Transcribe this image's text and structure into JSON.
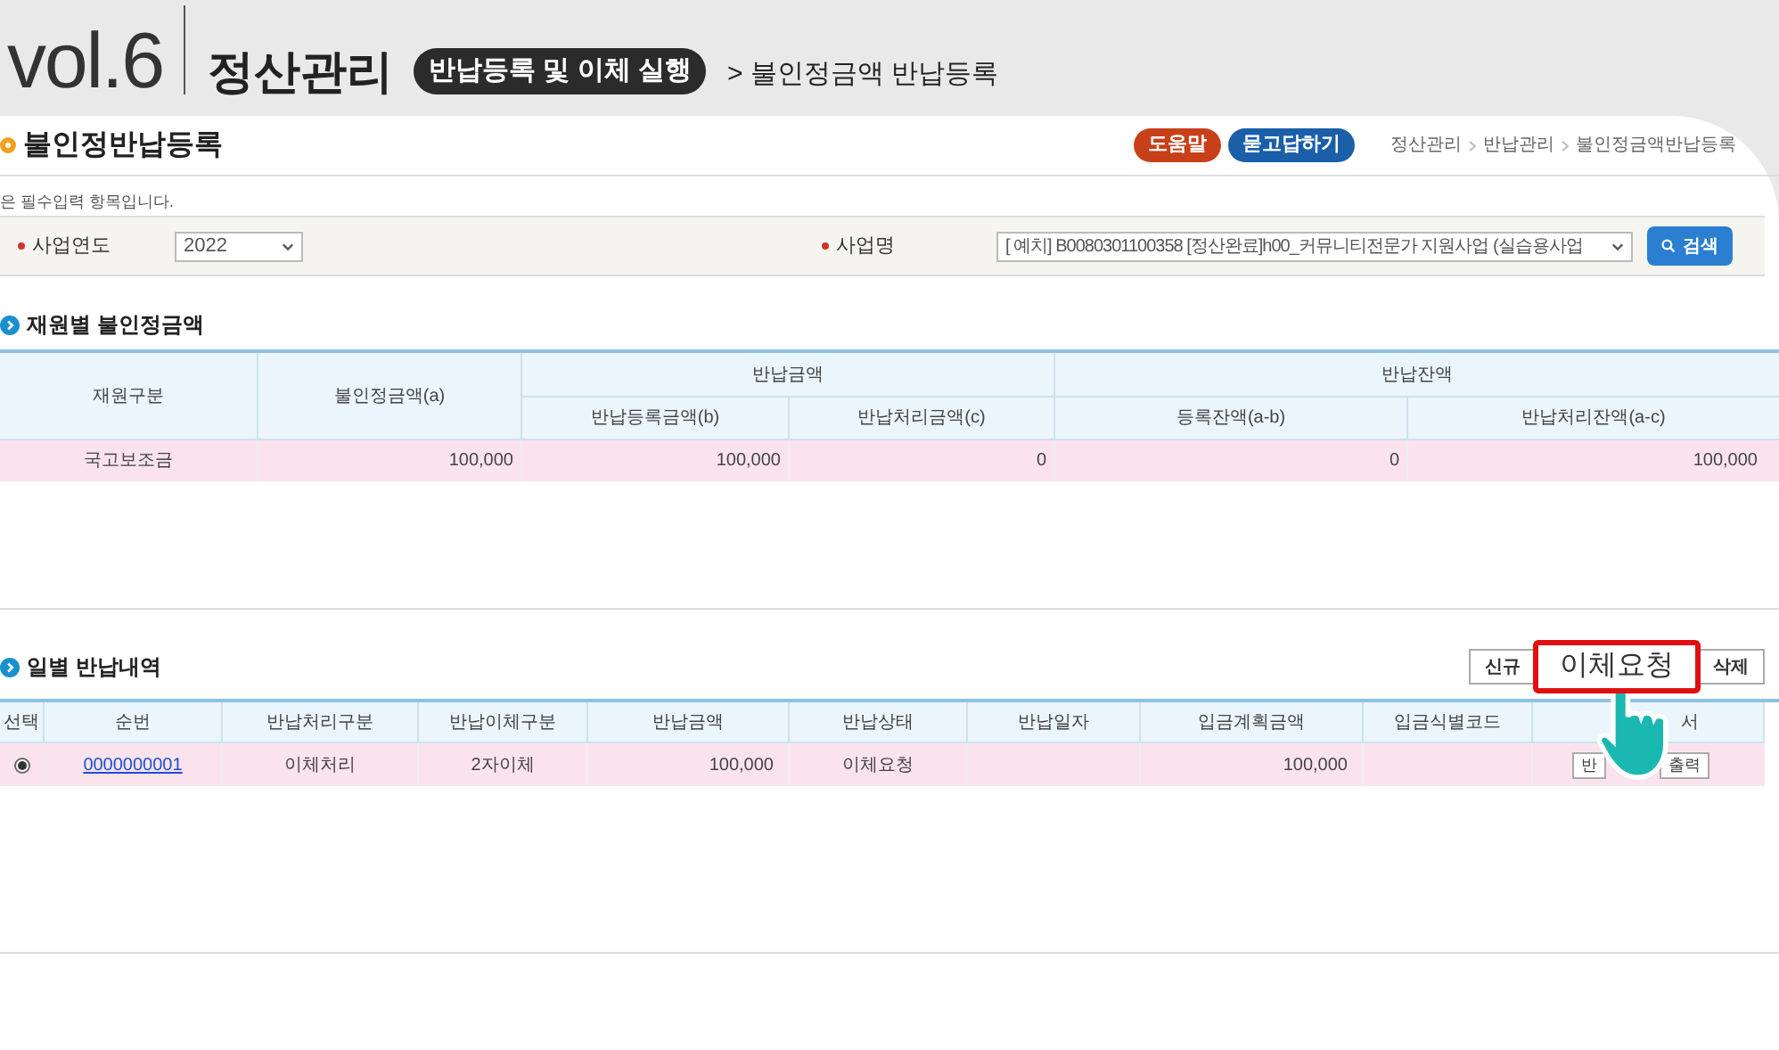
{
  "banner": {
    "volume": "vol.6",
    "section": "정산관리",
    "step": "반납등록 및 이체 실행",
    "subtitle": "> 불인정금액 반납등록"
  },
  "page_title": "불인정반납등록",
  "header_buttons": [
    {
      "label": "도움말",
      "color": "#c8401a"
    },
    {
      "label": "묻고답하기",
      "color": "#1a5fa8"
    }
  ],
  "breadcrumb": [
    "정산관리",
    "반납관리",
    "불인정금액반납등록"
  ],
  "required_note": "은 필수입력 항목입니다.",
  "search": {
    "year_label": "사업연도",
    "year_value": "2022",
    "business_label": "사업명",
    "business_value": "[    예치] B0080301100358 [정산완료]h00_커뮤니티전문가 지원사업 (실습용사업",
    "search_button": "검색"
  },
  "funds": {
    "title": "재원별 불인정금액",
    "header_top": [
      "재원구분",
      "불인정금액(a)",
      "반납금액",
      "반납잔액"
    ],
    "header_sub": [
      "반납등록금액(b)",
      "반납처리금액(c)",
      "등록잔액(a-b)",
      "반납처리잔액(a-c)"
    ],
    "rows": [
      [
        "국고보조금",
        "100,000",
        "100,000",
        "0",
        "0",
        "100,000"
      ]
    ]
  },
  "daily": {
    "title": "일별 반납내역",
    "buttons": [
      {
        "label": "신규",
        "highlighted": false
      },
      {
        "label": "이체요청",
        "highlighted": true
      },
      {
        "label": "삭제",
        "highlighted": false
      }
    ],
    "columns": [
      "선택",
      "순번",
      "반납처리구분",
      "반납이체구분",
      "반납금액",
      "반납상태",
      "반납일자",
      "입금계획금액",
      "입금식별코드",
      "서"
    ],
    "rows": [
      {
        "selected": true,
        "cells": [
          "",
          "0000000001",
          "이체처리",
          "2자이체",
          "100,000",
          "이체요청",
          "",
          "100,000",
          ""
        ],
        "actions": [
          "반",
          "출력"
        ]
      }
    ]
  }
}
